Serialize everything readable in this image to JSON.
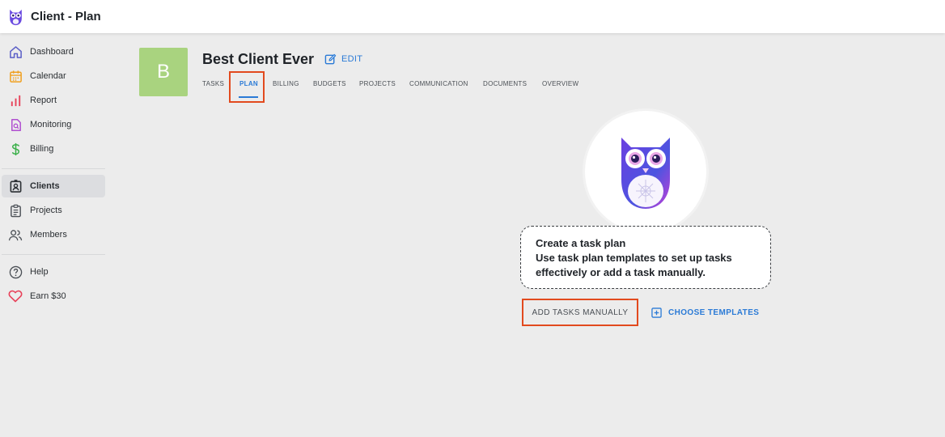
{
  "app": {
    "title": "Client - Plan",
    "logo_icon": "owl-logo-icon"
  },
  "sidebar": {
    "items": [
      {
        "label": "Dashboard",
        "icon": "home-icon",
        "color": "#5b5fc7"
      },
      {
        "label": "Calendar",
        "icon": "calendar-icon",
        "color": "#f0a020"
      },
      {
        "label": "Report",
        "icon": "bar-chart-icon",
        "color": "#e8425a"
      },
      {
        "label": "Monitoring",
        "icon": "monitoring-icon",
        "color": "#b04fd0"
      },
      {
        "label": "Billing",
        "icon": "dollar-icon",
        "color": "#3bb04a"
      },
      {
        "label": "Clients",
        "icon": "client-badge-icon",
        "color": "#2b2f33"
      },
      {
        "label": "Projects",
        "icon": "clipboard-icon",
        "color": "#4a4f55"
      },
      {
        "label": "Members",
        "icon": "members-icon",
        "color": "#4a4f55"
      },
      {
        "label": "Help",
        "icon": "help-icon",
        "color": "#4a4f55"
      },
      {
        "label": "Earn $30",
        "icon": "heart-icon",
        "color": "#e8425a"
      }
    ],
    "active": "Clients"
  },
  "client": {
    "avatar_letter": "B",
    "avatar_color": "#a9d37f",
    "name": "Best Client Ever",
    "edit_label": "EDIT"
  },
  "tabs": [
    "TASKS",
    "PLAN",
    "BILLING",
    "BUDGETS",
    "PROJECTS",
    "COMMUNICATION",
    "DOCUMENTS",
    "OVERVIEW"
  ],
  "active_tab": "PLAN",
  "empty_state": {
    "illustration": "owl-illustration",
    "line1": "Create a task plan",
    "line2": "Use task plan templates to set up tasks",
    "line3": "effectively or add a task manually."
  },
  "actions": {
    "add_manually": "ADD TASKS MANUALLY",
    "choose_templates": "CHOOSE TEMPLATES"
  },
  "colors": {
    "accent": "#2a7ad6",
    "highlight": "#e24a1e",
    "background": "#ececec"
  }
}
